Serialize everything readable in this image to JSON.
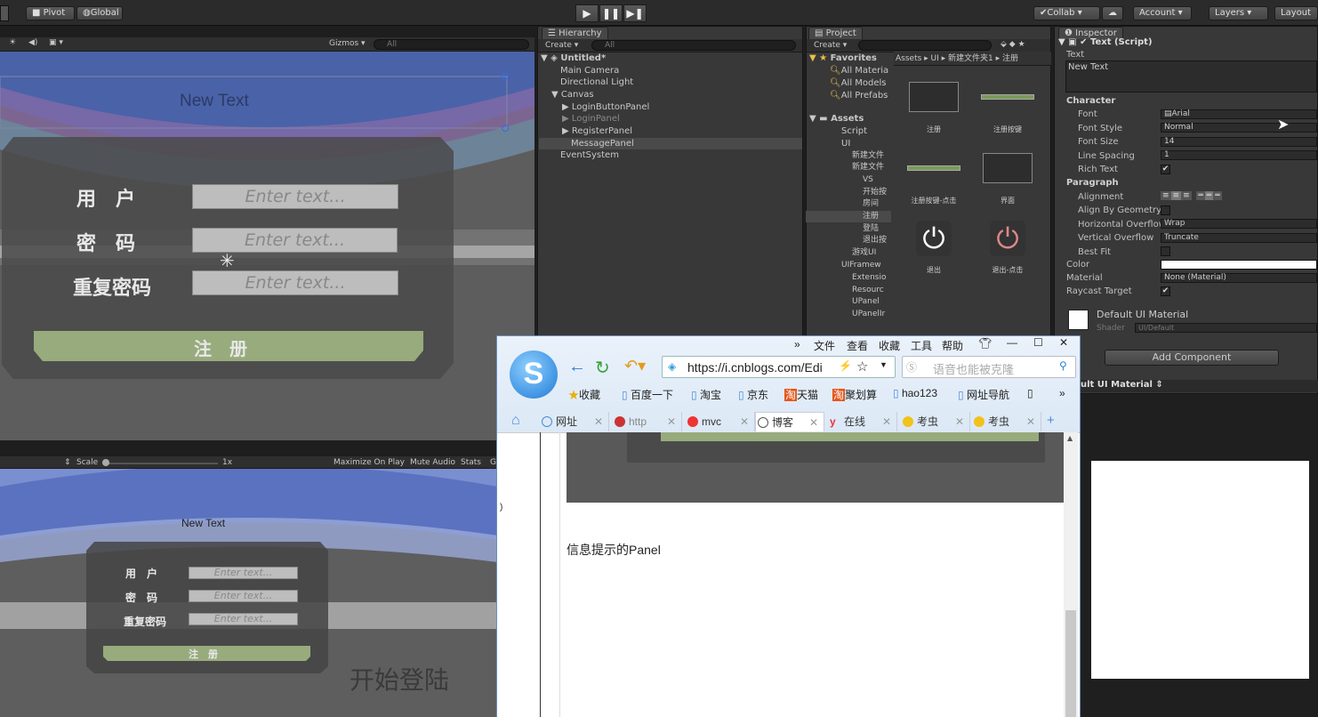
{
  "toolbar": {
    "pivot": "Pivot",
    "global": "Global",
    "collab": "Collab",
    "account": "Account",
    "layers": "Layers",
    "layout": "Layout"
  },
  "scene_view": {
    "gizmos": "Gizmos",
    "search_placeholder": "All",
    "new_text": "New Text",
    "labels": [
      "用　户",
      "密　码",
      "重复密码"
    ],
    "placeholder": "Enter text...",
    "register": "注　册"
  },
  "game_view": {
    "scale_label": "Scale",
    "scale_value": "1x",
    "maximize": "Maximize On Play",
    "mute": "Mute Audio",
    "stats": "Stats",
    "gizmos_short": "G",
    "new_text": "New Text",
    "labels": [
      "用　户",
      "密　码",
      "重复密码"
    ],
    "placeholder": "Enter text...",
    "register": "注　册",
    "start_login": "开始登陆"
  },
  "hierarchy": {
    "tab": "Hierarchy",
    "create": "Create",
    "search_placeholder": "All",
    "scene": "Untitled*",
    "items": [
      "Main Camera",
      "Directional Light",
      "Canvas",
      "LoginButtonPanel",
      "LoginPanel",
      "RegisterPanel",
      "MessagePanel",
      "EventSystem"
    ]
  },
  "project": {
    "tab": "Project",
    "create": "Create",
    "favorites": "Favorites",
    "fav_items": [
      "All Materia",
      "All Models",
      "All Prefabs"
    ],
    "assets": "Assets",
    "tree": [
      "Script",
      "UI",
      "新建文件",
      "新建文件",
      "VS",
      "开始按",
      "房间",
      "注册",
      "登陆",
      "退出按",
      "游戏UI",
      "UIFramew",
      "Extensio",
      "Resourc",
      "UPanel",
      "UPanelIr"
    ],
    "breadcrumb": [
      "Assets",
      "UI",
      "新建文件夹1",
      "注册"
    ],
    "asset_names": [
      "注册",
      "注册按键",
      "注册按键-点击",
      "界面",
      "退出",
      "退出-点击"
    ]
  },
  "inspector": {
    "tab": "Inspector",
    "component": "Text (Script)",
    "text_label": "Text",
    "text_value": "New Text",
    "character": "Character",
    "font_label": "Font",
    "font_value": "Arial",
    "font_style_label": "Font Style",
    "font_style_value": "Normal",
    "font_size_label": "Font Size",
    "font_size_value": "14",
    "line_spacing_label": "Line Spacing",
    "line_spacing_value": "1",
    "rich_text_label": "Rich Text",
    "paragraph": "Paragraph",
    "alignment_label": "Alignment",
    "align_geometry_label": "Align By Geometry",
    "h_overflow_label": "Horizontal Overflow",
    "h_overflow_value": "Wrap",
    "v_overflow_label": "Vertical Overflow",
    "v_overflow_value": "Truncate",
    "best_fit_label": "Best Fit",
    "color_label": "Color",
    "material_label": "Material",
    "material_value": "None (Material)",
    "raycast_label": "Raycast Target",
    "default_material": "Default UI Material",
    "shader_label": "Shader",
    "shader_value": "UI/Default",
    "add_component": "Add Component",
    "preview_title": "ult UI Material"
  },
  "browser": {
    "menu": [
      "文件",
      "查看",
      "收藏",
      "工具",
      "帮助"
    ],
    "url": "https://i.cnblogs.com/Edi",
    "search_placeholder": "语音也能被克隆",
    "bookmarks": [
      "收藏",
      "百度一下",
      "淘宝",
      "京东",
      "天猫",
      "聚划算",
      "hao123",
      "网址导航"
    ],
    "tabs": [
      "网址",
      "http",
      "mvc",
      "博客",
      "在线",
      "考虫",
      "考虫"
    ],
    "caption": "信息提示的Panel",
    "margin_char": ")"
  },
  "colors": {
    "unity_bg": "#383838",
    "register_green": "#98ab7d",
    "browser_accent": "#2d9cdb"
  }
}
